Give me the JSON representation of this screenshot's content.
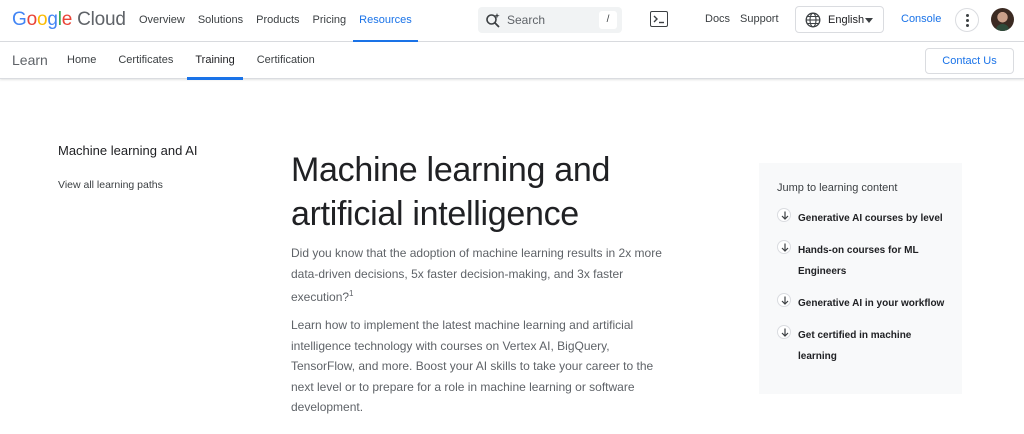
{
  "header": {
    "logo": {
      "google": [
        "G",
        "o",
        "o",
        "g",
        "l",
        "e"
      ],
      "product": "Cloud"
    },
    "nav": [
      {
        "label": "Overview",
        "active": false
      },
      {
        "label": "Solutions",
        "active": false
      },
      {
        "label": "Products",
        "active": false
      },
      {
        "label": "Pricing",
        "active": false
      },
      {
        "label": "Resources",
        "active": true
      }
    ],
    "search": {
      "placeholder": "Search",
      "shortcut": "/"
    },
    "links": {
      "docs": "Docs",
      "support": "Support",
      "console": "Console"
    },
    "language": "English",
    "icons": {
      "search": "search-spark-icon",
      "terminal": "terminal-icon",
      "language": "globe-icon",
      "more": "more-vert-icon"
    },
    "accent_color": "#1a73e8"
  },
  "subheader": {
    "section": "Learn",
    "nav": [
      {
        "label": "Home",
        "active": false
      },
      {
        "label": "Certificates",
        "active": false
      },
      {
        "label": "Training",
        "active": true
      },
      {
        "label": "Certification",
        "active": false
      }
    ],
    "contact_label": "Contact Us"
  },
  "sidebar": {
    "title": "Machine learning and AI",
    "link": "View all learning paths"
  },
  "main": {
    "title": "Machine learning and artificial intelligence",
    "para1": "Did you know that the adoption of machine learning results in 2x more data-driven decisions, 5x faster decision-making, and 3x faster execution?",
    "para1_footnote": "1",
    "para2": "Learn how to implement the latest machine learning and artificial intelligence technology with courses on Vertex AI, BigQuery, TensorFlow, and more. Boost your AI skills to take your career to the next level or to prepare for a role in machine learning or software development."
  },
  "jump": {
    "title": "Jump to learning content",
    "items": [
      {
        "label": "Generative AI courses by level"
      },
      {
        "label": "Hands-on courses for ML Engineers"
      },
      {
        "label": "Generative AI in your workflow"
      },
      {
        "label": "Get certified in machine learning"
      }
    ]
  }
}
